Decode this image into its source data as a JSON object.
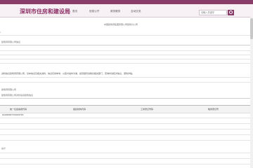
{
  "header": {
    "logo": "深圳市住房和建设局",
    "nav": [
      "首页",
      "信息公开",
      "政务服务",
      "互动交流"
    ],
    "search_placeholder": "请输入关键字"
  },
  "company": {
    "name": "中国建筑局集团有限公司建筑分公司",
    "basic_info_title": "建筑局有限公司信息"
  },
  "section2_title": "建筑局有限公司",
  "notice_text": "资料信息建筑局有限公司，基本信息及相关资料，信息仅供参考，以官方发布为准，如有疑问请联系相关部门，查询时请核对信息，谨防诈骗。",
  "section3_title": "建筑局有限公司对外投资建筑信息",
  "table": {
    "headers": [
      "统一社会信用代码",
      "组织机构代码",
      "工商登记号码",
      "税务登记号"
    ],
    "rows": [
      [
        "91430000770404372S",
        "",
        "",
        ""
      ]
    ]
  },
  "footer_label": "总计"
}
